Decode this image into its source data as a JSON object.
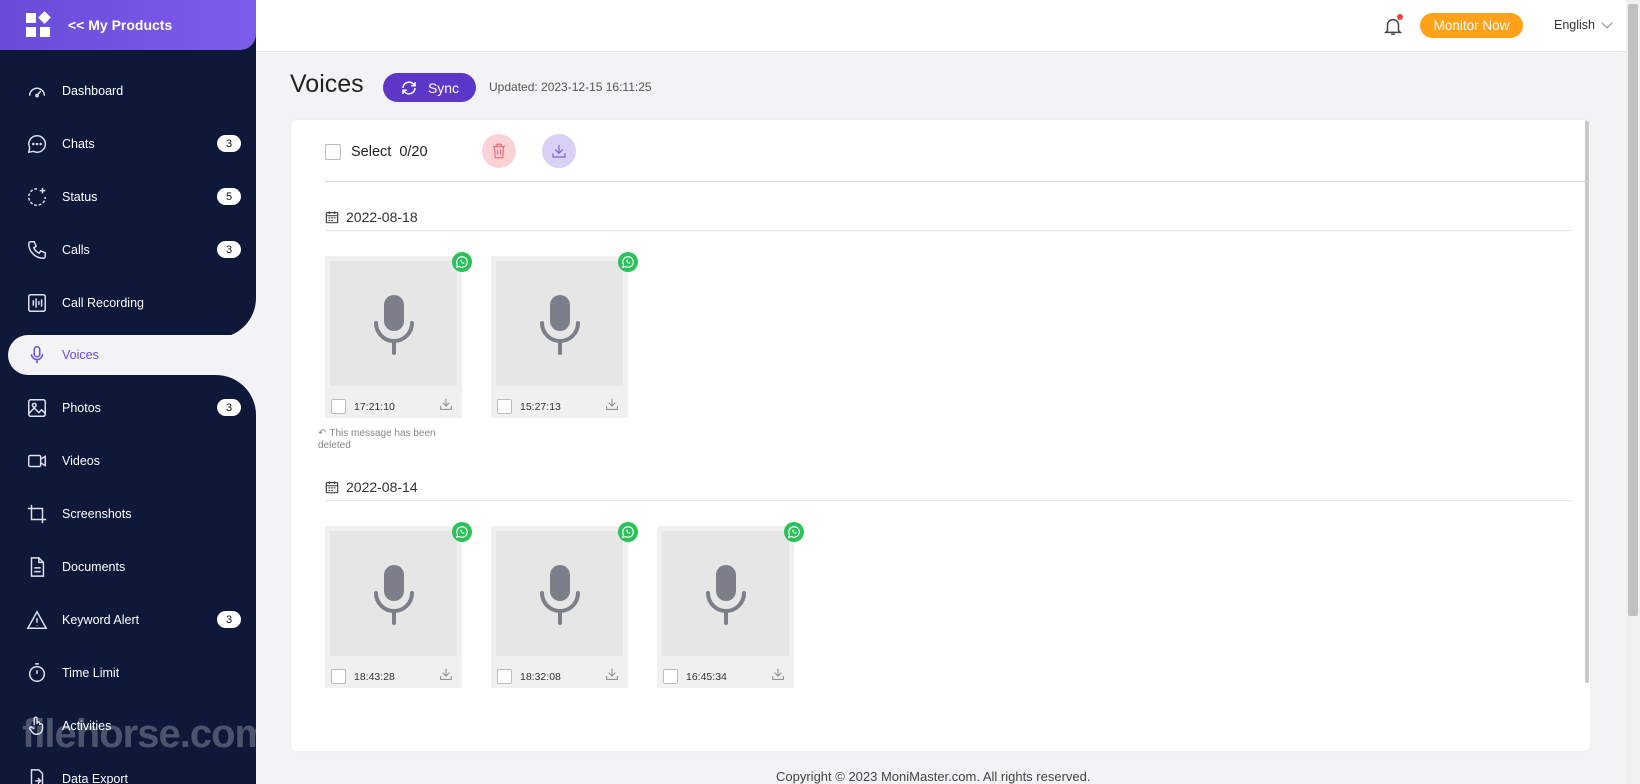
{
  "sidebar": {
    "header": {
      "title": "<< My Products"
    },
    "items": [
      {
        "label": "Dashboard",
        "icon": "dashboard-icon",
        "badge": ""
      },
      {
        "label": "Chats",
        "icon": "chat-icon",
        "badge": "3"
      },
      {
        "label": "Status",
        "icon": "status-icon",
        "badge": "5"
      },
      {
        "label": "Calls",
        "icon": "phone-icon",
        "badge": "3"
      },
      {
        "label": "Call Recording",
        "icon": "waveform-icon",
        "badge": ""
      },
      {
        "label": "Voices",
        "icon": "microphone-icon",
        "badge": ""
      },
      {
        "label": "Photos",
        "icon": "photo-icon",
        "badge": "3"
      },
      {
        "label": "Videos",
        "icon": "video-icon",
        "badge": ""
      },
      {
        "label": "Screenshots",
        "icon": "crop-icon",
        "badge": ""
      },
      {
        "label": "Documents",
        "icon": "document-icon",
        "badge": ""
      },
      {
        "label": "Keyword Alert",
        "icon": "alert-icon",
        "badge": "3"
      },
      {
        "label": "Time Limit",
        "icon": "stopwatch-icon",
        "badge": ""
      },
      {
        "label": "Activities",
        "icon": "hand-pointer-icon",
        "badge": ""
      },
      {
        "label": "Data Export",
        "icon": "export-icon",
        "badge": ""
      }
    ],
    "active": "Voices",
    "watermark": "filehorse.com"
  },
  "topbar": {
    "monitor_label": "Monitor Now",
    "language": "English"
  },
  "main": {
    "title": "Voices",
    "sync_label": "Sync",
    "updated": "Updated: 2023-12-15 16:11:25",
    "toolbar": {
      "select_label": "Select",
      "select_count": "0/20"
    },
    "groups": [
      {
        "date": "2022-08-18",
        "items": [
          {
            "time": "17:21:10",
            "deleted_note": "This message has been deleted"
          },
          {
            "time": "15:27:13"
          }
        ]
      },
      {
        "date": "2022-08-14",
        "items": [
          {
            "time": "18:43:28"
          },
          {
            "time": "18:32:08"
          },
          {
            "time": "16:45:34"
          }
        ]
      }
    ]
  },
  "footer": {
    "copyright": "Copyright © 2023 MoniMaster.com. All rights reserved."
  },
  "colors": {
    "sidebar_bg": "#0e1838",
    "accent": "#6a4bd8",
    "monitor_btn": "#ffa21a",
    "whatsapp": "#2bc25b"
  }
}
